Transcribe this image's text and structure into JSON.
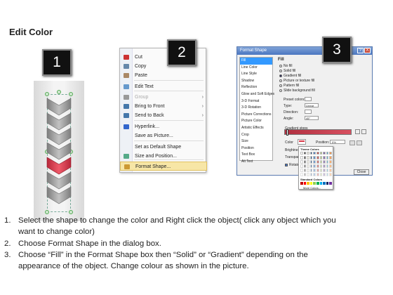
{
  "page_title": "Edit Color",
  "badges": [
    "1",
    "2",
    "3"
  ],
  "context_menu": {
    "items": [
      {
        "label": "Cut",
        "icon": "scissors-icon",
        "disabled": false
      },
      {
        "label": "Copy",
        "icon": "copy-icon",
        "disabled": false
      },
      {
        "label": "Paste",
        "icon": "paste-icon",
        "disabled": false
      },
      {
        "label": "Edit Text",
        "icon": "edit-text-icon",
        "disabled": false
      },
      {
        "label": "Group",
        "icon": "group-icon",
        "disabled": true,
        "submenu": true
      },
      {
        "label": "Bring to Front",
        "icon": "bring-front-icon",
        "disabled": false,
        "submenu": true
      },
      {
        "label": "Send to Back",
        "icon": "send-back-icon",
        "disabled": false,
        "submenu": true
      },
      {
        "label": "Hyperlink...",
        "icon": "hyperlink-icon",
        "disabled": false
      },
      {
        "label": "Save as Picture...",
        "icon": "",
        "disabled": false
      },
      {
        "label": "Set as Default Shape",
        "icon": "",
        "disabled": false
      },
      {
        "label": "Size and Position...",
        "icon": "size-icon",
        "disabled": false
      },
      {
        "label": "Format Shape...",
        "icon": "format-shape-icon",
        "disabled": false,
        "highlighted": true
      }
    ],
    "submenu_arrow": "›"
  },
  "dialog": {
    "title": "Format Shape",
    "help": "?",
    "close": "X",
    "categories": [
      "Fill",
      "Line Color",
      "Line Style",
      "Shadow",
      "Reflection",
      "Glow and Soft Edges",
      "3-D Format",
      "3-D Rotation",
      "Picture Corrections",
      "Picture Color",
      "Artistic Effects",
      "Crop",
      "Size",
      "Position",
      "Text Box",
      "Alt Text"
    ],
    "fill_heading": "Fill",
    "fill_options": [
      "No fill",
      "Solid fill",
      "Gradient fill",
      "Picture or texture fill",
      "Pattern fill",
      "Slide background fill"
    ],
    "selected_fill": "Gradient fill",
    "fields": [
      {
        "label": "Preset colors:",
        "value": ""
      },
      {
        "label": "Type:",
        "value": "Linear"
      },
      {
        "label": "Direction:",
        "value": ""
      },
      {
        "label": "Angle:",
        "value": "45°"
      }
    ],
    "gradient_stops_label": "Gradient stops",
    "color_label": "Color",
    "position_label": "Position:",
    "position_value": "0%",
    "brightness_label": "Brightness",
    "transparency_label": "Transparenc",
    "rotate_label": "Rotate",
    "palette": {
      "theme_title": "Theme Colors",
      "standard_title": "Standard Colors",
      "more_label": "More Colors..."
    },
    "close_button": "Close"
  },
  "instructions": [
    {
      "num": "1.",
      "lines": [
        "Select the shape to change the color and Right click the object( click any object which you",
        "want to change color)"
      ]
    },
    {
      "num": "2.",
      "lines": [
        "Choose Format Shape in the dialog box."
      ]
    },
    {
      "num": "3.",
      "lines": [
        "Choose “Fill” in the Format Shape box then “Solid” or “Gradient” depending on the",
        "appearance of the object. Change colour as shown in the picture."
      ]
    }
  ],
  "colors": {
    "accent_red": "#d83a4a",
    "chevron_grey": "#9a9a9a",
    "dialog_blue": "#4a76c0",
    "menu_highlight": "#f7e6a6"
  }
}
